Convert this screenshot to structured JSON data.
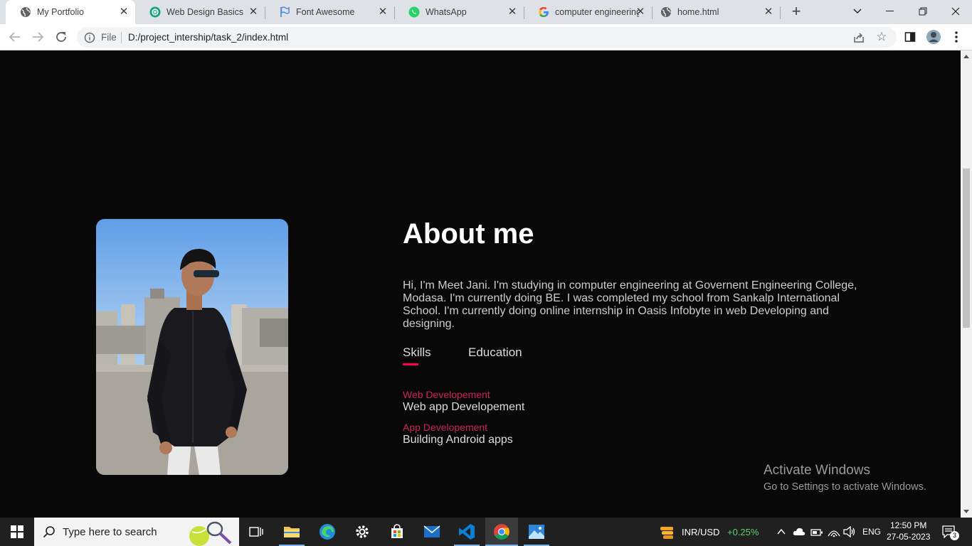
{
  "browser": {
    "tabs": [
      {
        "title": "My Portfolio",
        "icon": "globe-icon",
        "active": true
      },
      {
        "title": "Web Design Basics",
        "icon": "chatgpt-icon",
        "active": false
      },
      {
        "title": "Font Awesome",
        "icon": "flag-icon",
        "active": false
      },
      {
        "title": "WhatsApp",
        "icon": "whatsapp-icon",
        "active": false
      },
      {
        "title": "computer engineering",
        "icon": "google-icon",
        "active": false
      },
      {
        "title": "home.html",
        "icon": "globe-icon",
        "active": false
      }
    ],
    "address": {
      "scheme_label": "File",
      "url": "D:/project_intership/task_2/index.html"
    }
  },
  "page": {
    "about_title": "About me",
    "about_text": "Hi, I'm Meet Jani. I'm studying in computer engineering at Governent Engineering College, Modasa. I'm currently doing BE. I was completed my school from Sankalp International School. I'm currently doing online internship in Oasis Infobyte in web Developing and designing.",
    "tab_links": [
      "Skills",
      "Education"
    ],
    "skills": [
      {
        "category": "Web Developement",
        "description": "Web app Developement"
      },
      {
        "category": "App Developement",
        "description": "Building Android apps"
      }
    ],
    "accent_color": "#ff004f"
  },
  "watermark": {
    "line1": "Activate Windows",
    "line2": "Go to Settings to activate Windows."
  },
  "taskbar": {
    "search_placeholder": "Type here to search",
    "currency_label": "INR/USD",
    "currency_change": "+0.25%",
    "language": "ENG",
    "time": "12:50 PM",
    "date": "27-05-2023",
    "notification_count": "3"
  }
}
